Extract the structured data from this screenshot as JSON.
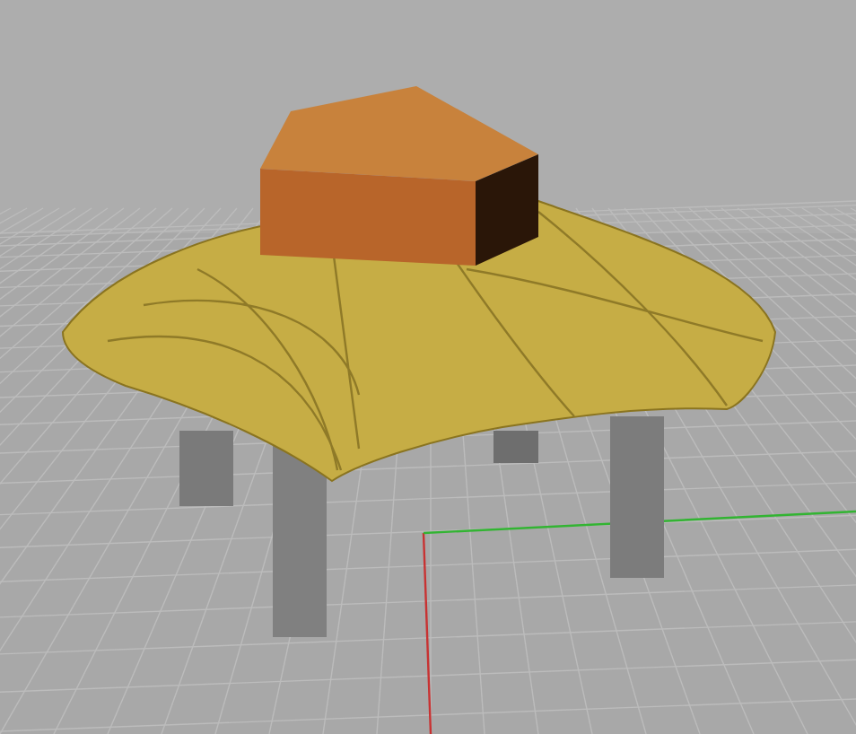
{
  "axes": [
    {
      "kind": "x",
      "color": "#c83232"
    },
    {
      "kind": "y",
      "color": "#32b432"
    }
  ]
}
